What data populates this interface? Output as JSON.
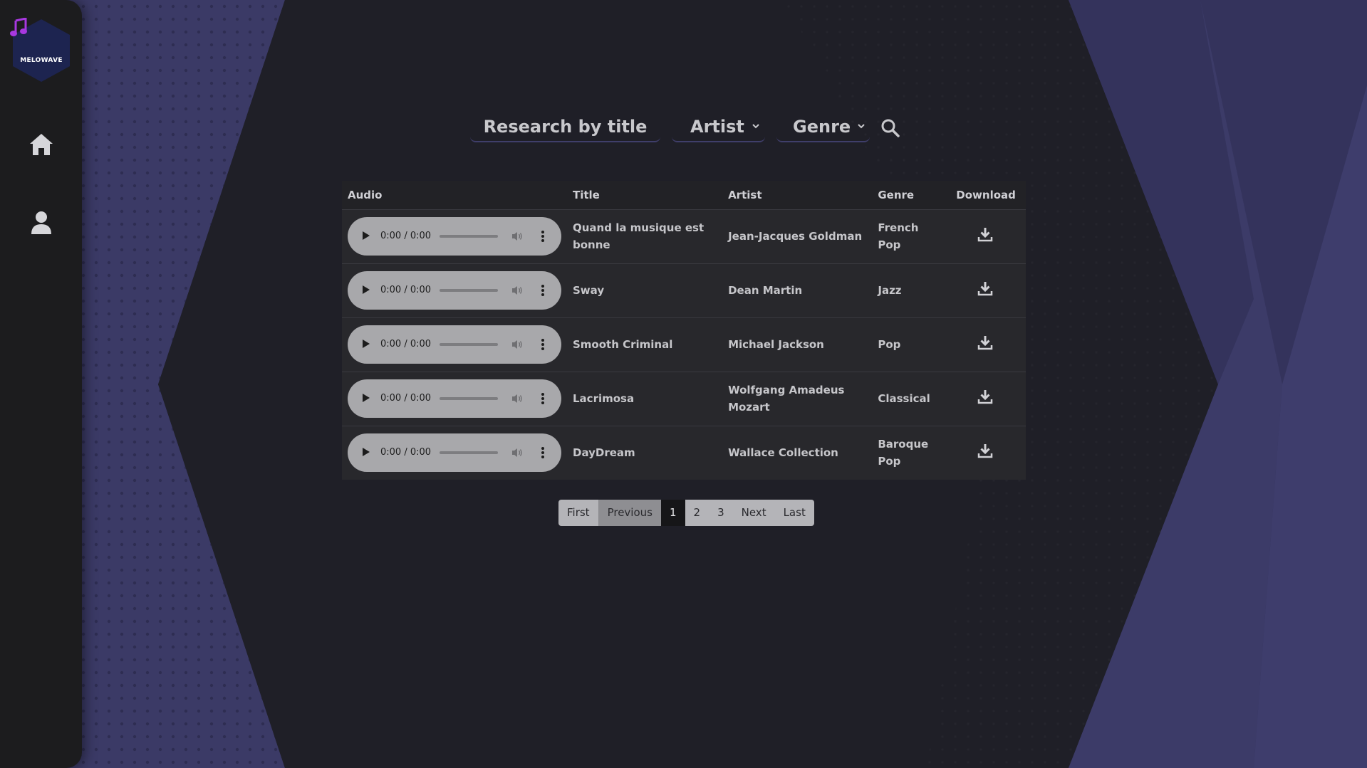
{
  "app": {
    "logo_text": "MELOWAVE",
    "logo_color": "#1d2450",
    "logo_note_color": "#a838e0"
  },
  "sidebar": {
    "items": [
      {
        "name": "home",
        "icon": "home-icon"
      },
      {
        "name": "profile",
        "icon": "user-icon"
      }
    ]
  },
  "search": {
    "title_placeholder": "Research by title",
    "artist_label": "Artist",
    "genre_label": "Genre",
    "search_icon": "search-icon"
  },
  "table": {
    "headers": {
      "audio": "Audio",
      "title": "Title",
      "artist": "Artist",
      "genre": "Genre",
      "download": "Download"
    },
    "rows": [
      {
        "time": "0:00 / 0:00",
        "title": "Quand la musique est bonne",
        "artist": "Jean-Jacques Goldman",
        "genre": "French Pop"
      },
      {
        "time": "0:00 / 0:00",
        "title": "Sway",
        "artist": "Dean Martin",
        "genre": "Jazz"
      },
      {
        "time": "0:00 / 0:00",
        "title": "Smooth Criminal",
        "artist": "Michael Jackson",
        "genre": "Pop"
      },
      {
        "time": "0:00 / 0:00",
        "title": "Lacrimosa",
        "artist": "Wolfgang Amadeus Mozart",
        "genre": "Classical"
      },
      {
        "time": "0:00 / 0:00",
        "title": "DayDream",
        "artist": "Wallace Collection",
        "genre": "Baroque Pop"
      }
    ]
  },
  "pagination": {
    "first": "First",
    "previous": "Previous",
    "pages": [
      "1",
      "2",
      "3"
    ],
    "current_page": "1",
    "next": "Next",
    "last": "Last"
  },
  "colors": {
    "background_dark": "#1f1f27",
    "background_accent": "#3b3a66",
    "sidebar": "#1c1c1e",
    "row_background": "#28282c"
  }
}
